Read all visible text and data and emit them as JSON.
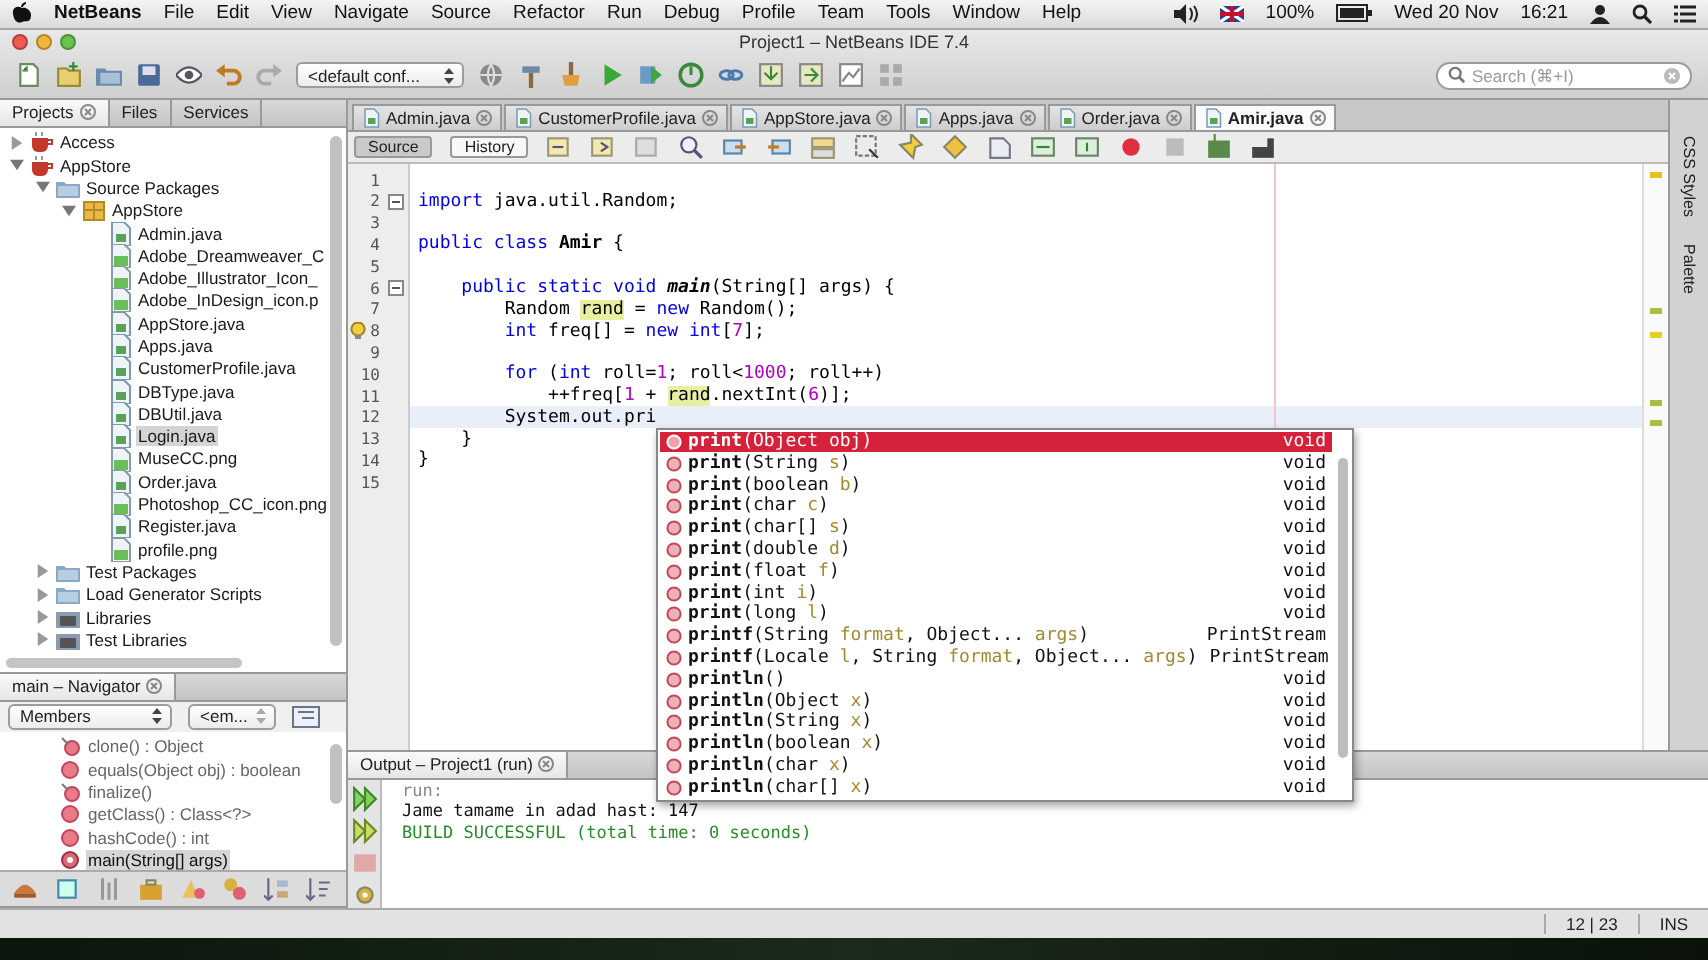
{
  "menubar": {
    "app": "NetBeans",
    "menus": [
      "File",
      "Edit",
      "View",
      "Navigate",
      "Source",
      "Refactor",
      "Run",
      "Debug",
      "Profile",
      "Team",
      "Tools",
      "Window",
      "Help"
    ],
    "battery": "100%",
    "date": "Wed 20 Nov",
    "time": "16:21"
  },
  "window": {
    "title": "Project1 – NetBeans IDE 7.4"
  },
  "toolbar": {
    "config": "<default conf...",
    "search": {
      "placeholder": "Search (⌘+I)"
    }
  },
  "projects_panel": {
    "tabs": [
      {
        "label": "Projects",
        "selected": true
      },
      {
        "label": "Files",
        "selected": false
      },
      {
        "label": "Services",
        "selected": false
      }
    ],
    "tree": [
      {
        "label": "Access",
        "kind": "project",
        "expanded": false,
        "selected": false
      },
      {
        "label": "AppStore",
        "kind": "project",
        "expanded": true,
        "selected": false,
        "children": [
          {
            "label": "Source Packages",
            "kind": "folder",
            "expanded": true,
            "selected": false,
            "children": [
              {
                "label": "AppStore",
                "kind": "package",
                "expanded": true,
                "selected": false,
                "children": [
                  {
                    "label": "Admin.java",
                    "kind": "java",
                    "selected": false
                  },
                  {
                    "label": "Adobe_Dreamweaver_C",
                    "kind": "image",
                    "selected": false
                  },
                  {
                    "label": "Adobe_Illustrator_Icon_",
                    "kind": "image",
                    "selected": false
                  },
                  {
                    "label": "Adobe_InDesign_icon.p",
                    "kind": "image",
                    "selected": false
                  },
                  {
                    "label": "AppStore.java",
                    "kind": "java",
                    "selected": false
                  },
                  {
                    "label": "Apps.java",
                    "kind": "java",
                    "selected": false
                  },
                  {
                    "label": "CustomerProfile.java",
                    "kind": "java",
                    "selected": false
                  },
                  {
                    "label": "DBType.java",
                    "kind": "java",
                    "selected": false
                  },
                  {
                    "label": "DBUtil.java",
                    "kind": "java",
                    "selected": false
                  },
                  {
                    "label": "Login.java",
                    "kind": "java",
                    "selected": true
                  },
                  {
                    "label": "MuseCC.png",
                    "kind": "image",
                    "selected": false
                  },
                  {
                    "label": "Order.java",
                    "kind": "java",
                    "selected": false
                  },
                  {
                    "label": "Photoshop_CC_icon.png",
                    "kind": "image",
                    "selected": false
                  },
                  {
                    "label": "Register.java",
                    "kind": "java",
                    "selected": false
                  },
                  {
                    "label": "profile.png",
                    "kind": "image",
                    "selected": false
                  }
                ]
              }
            ]
          },
          {
            "label": "Test Packages",
            "kind": "folder",
            "expanded": false,
            "selected": false
          },
          {
            "label": "Load Generator Scripts",
            "kind": "folder",
            "expanded": false,
            "selected": false
          },
          {
            "label": "Libraries",
            "kind": "library",
            "expanded": false,
            "selected": false
          },
          {
            "label": "Test Libraries",
            "kind": "library",
            "expanded": false,
            "selected": false
          }
        ]
      }
    ]
  },
  "navigator": {
    "title": "main – Navigator",
    "filter": "Members",
    "secondary": "<em...",
    "items": [
      {
        "label": "clone() : Object",
        "kind": "protected",
        "selected": false
      },
      {
        "label": "equals(Object obj) : boolean",
        "kind": "public",
        "selected": false
      },
      {
        "label": "finalize()",
        "kind": "protected",
        "selected": false
      },
      {
        "label": "getClass() : Class<?>",
        "kind": "public",
        "selected": false
      },
      {
        "label": "hashCode() : int",
        "kind": "public",
        "selected": false
      },
      {
        "label": "main(String[] args)",
        "kind": "static",
        "selected": true
      }
    ]
  },
  "editor": {
    "tabs": [
      {
        "label": "Admin.java",
        "selected": false
      },
      {
        "label": "CustomerProfile.java",
        "selected": false
      },
      {
        "label": "AppStore.java",
        "selected": false
      },
      {
        "label": "Apps.java",
        "selected": false
      },
      {
        "label": "Order.java",
        "selected": false
      },
      {
        "label": "Amir.java",
        "selected": true
      }
    ],
    "views": [
      {
        "label": "Source",
        "selected": true
      },
      {
        "label": "History",
        "selected": false
      }
    ],
    "lines": [
      {
        "number": "1",
        "fold": false,
        "hint": false,
        "current": false
      },
      {
        "number": "2",
        "fold": true,
        "hint": false,
        "current": false,
        "tokens": [
          {
            "text": "import",
            "kind": "kw"
          },
          {
            "text": " java.util.Random;",
            "kind": "plain"
          }
        ]
      },
      {
        "number": "3",
        "fold": false,
        "hint": false,
        "current": false
      },
      {
        "number": "4",
        "fold": false,
        "hint": false,
        "current": false,
        "tokens": [
          {
            "text": "public class",
            "kind": "kw"
          },
          {
            "text": " Amir",
            "kind": "bold"
          },
          {
            "text": " {",
            "kind": "plain"
          }
        ]
      },
      {
        "number": "5",
        "fold": false,
        "hint": false,
        "current": false
      },
      {
        "number": "6",
        "fold": true,
        "hint": false,
        "current": false,
        "tokens": [
          {
            "text": "    public static void",
            "kind": "kw"
          },
          {
            "text": " main",
            "kind": "method"
          },
          {
            "text": "(String[] args) {",
            "kind": "plain"
          }
        ]
      },
      {
        "number": "7",
        "fold": false,
        "hint": false,
        "current": false,
        "tokens": [
          {
            "text": "        Random ",
            "kind": "plain"
          },
          {
            "text": "rand",
            "kind": "mark"
          },
          {
            "text": " = ",
            "kind": "plain"
          },
          {
            "text": "new",
            "kind": "kw"
          },
          {
            "text": " Random();",
            "kind": "plain"
          }
        ]
      },
      {
        "number": "8",
        "fold": false,
        "hint": true,
        "current": false,
        "tokens": [
          {
            "text": "        int",
            "kind": "kw"
          },
          {
            "text": " freq[] = ",
            "kind": "plain"
          },
          {
            "text": "new int",
            "kind": "kw"
          },
          {
            "text": "[",
            "kind": "plain"
          },
          {
            "text": "7",
            "kind": "num"
          },
          {
            "text": "];",
            "kind": "plain"
          }
        ]
      },
      {
        "number": "9",
        "fold": false,
        "hint": false,
        "current": false
      },
      {
        "number": "10",
        "fold": false,
        "hint": false,
        "current": false,
        "tokens": [
          {
            "text": "        for",
            "kind": "kw"
          },
          {
            "text": " (",
            "kind": "plain"
          },
          {
            "text": "int",
            "kind": "kw"
          },
          {
            "text": " roll=",
            "kind": "plain"
          },
          {
            "text": "1",
            "kind": "num"
          },
          {
            "text": "; roll<",
            "kind": "plain"
          },
          {
            "text": "1000",
            "kind": "num"
          },
          {
            "text": "; roll++)",
            "kind": "plain"
          }
        ]
      },
      {
        "number": "11",
        "fold": false,
        "hint": false,
        "current": false,
        "tokens": [
          {
            "text": "            ++freq[",
            "kind": "plain"
          },
          {
            "text": "1",
            "kind": "num"
          },
          {
            "text": " + ",
            "kind": "plain"
          },
          {
            "text": "rand",
            "kind": "mark"
          },
          {
            "text": ".nextInt(",
            "kind": "plain"
          },
          {
            "text": "6",
            "kind": "num"
          },
          {
            "text": ")];",
            "kind": "plain"
          }
        ]
      },
      {
        "number": "12",
        "fold": false,
        "hint": false,
        "current": true,
        "tokens": [
          {
            "text": "        System.out.pri",
            "kind": "plain"
          }
        ]
      },
      {
        "number": "13",
        "fold": false,
        "hint": false,
        "current": false,
        "tokens": [
          {
            "text": "    }",
            "kind": "plain"
          }
        ]
      },
      {
        "number": "14",
        "fold": false,
        "hint": false,
        "current": false,
        "tokens": [
          {
            "text": "}",
            "kind": "plain"
          }
        ]
      },
      {
        "number": "15",
        "fold": false,
        "hint": false,
        "current": false
      }
    ],
    "completion": {
      "items": [
        {
          "selected": true,
          "tokens": [
            {
              "text": "print",
              "kind": "name"
            },
            {
              "text": "(Object ",
              "kind": "type"
            },
            {
              "text": "obj",
              "kind": "param"
            },
            {
              "text": ")",
              "kind": "type"
            }
          ],
          "returns": "void"
        },
        {
          "selected": false,
          "tokens": [
            {
              "text": "print",
              "kind": "name"
            },
            {
              "text": "(String ",
              "kind": "type"
            },
            {
              "text": "s",
              "kind": "param"
            },
            {
              "text": ")",
              "kind": "type"
            }
          ],
          "returns": "void"
        },
        {
          "selected": false,
          "tokens": [
            {
              "text": "print",
              "kind": "name"
            },
            {
              "text": "(boolean ",
              "kind": "type"
            },
            {
              "text": "b",
              "kind": "param"
            },
            {
              "text": ")",
              "kind": "type"
            }
          ],
          "returns": "void"
        },
        {
          "selected": false,
          "tokens": [
            {
              "text": "print",
              "kind": "name"
            },
            {
              "text": "(char ",
              "kind": "type"
            },
            {
              "text": "c",
              "kind": "param"
            },
            {
              "text": ")",
              "kind": "type"
            }
          ],
          "returns": "void"
        },
        {
          "selected": false,
          "tokens": [
            {
              "text": "print",
              "kind": "name"
            },
            {
              "text": "(char[] ",
              "kind": "type"
            },
            {
              "text": "s",
              "kind": "param"
            },
            {
              "text": ")",
              "kind": "type"
            }
          ],
          "returns": "void"
        },
        {
          "selected": false,
          "tokens": [
            {
              "text": "print",
              "kind": "name"
            },
            {
              "text": "(double ",
              "kind": "type"
            },
            {
              "text": "d",
              "kind": "param"
            },
            {
              "text": ")",
              "kind": "type"
            }
          ],
          "returns": "void"
        },
        {
          "selected": false,
          "tokens": [
            {
              "text": "print",
              "kind": "name"
            },
            {
              "text": "(float ",
              "kind": "type"
            },
            {
              "text": "f",
              "kind": "param"
            },
            {
              "text": ")",
              "kind": "type"
            }
          ],
          "returns": "void"
        },
        {
          "selected": false,
          "tokens": [
            {
              "text": "print",
              "kind": "name"
            },
            {
              "text": "(int ",
              "kind": "type"
            },
            {
              "text": "i",
              "kind": "param"
            },
            {
              "text": ")",
              "kind": "type"
            }
          ],
          "returns": "void"
        },
        {
          "selected": false,
          "tokens": [
            {
              "text": "print",
              "kind": "name"
            },
            {
              "text": "(long ",
              "kind": "type"
            },
            {
              "text": "l",
              "kind": "param"
            },
            {
              "text": ")",
              "kind": "type"
            }
          ],
          "returns": "void"
        },
        {
          "selected": false,
          "tokens": [
            {
              "text": "printf",
              "kind": "name"
            },
            {
              "text": "(String ",
              "kind": "type"
            },
            {
              "text": "format",
              "kind": "param"
            },
            {
              "text": ", Object... ",
              "kind": "type"
            },
            {
              "text": "args",
              "kind": "param"
            },
            {
              "text": ")",
              "kind": "type"
            }
          ],
          "returns": "PrintStream"
        },
        {
          "selected": false,
          "tokens": [
            {
              "text": "printf",
              "kind": "name"
            },
            {
              "text": "(Locale ",
              "kind": "type"
            },
            {
              "text": "l",
              "kind": "param"
            },
            {
              "text": ", String ",
              "kind": "type"
            },
            {
              "text": "format",
              "kind": "param"
            },
            {
              "text": ", Object... ",
              "kind": "type"
            },
            {
              "text": "args",
              "kind": "param"
            },
            {
              "text": ")",
              "kind": "type"
            }
          ],
          "returns": "PrintStream"
        },
        {
          "selected": false,
          "tokens": [
            {
              "text": "println",
              "kind": "name"
            },
            {
              "text": "()",
              "kind": "type"
            }
          ],
          "returns": "void"
        },
        {
          "selected": false,
          "tokens": [
            {
              "text": "println",
              "kind": "name"
            },
            {
              "text": "(Object ",
              "kind": "type"
            },
            {
              "text": "x",
              "kind": "param"
            },
            {
              "text": ")",
              "kind": "type"
            }
          ],
          "returns": "void"
        },
        {
          "selected": false,
          "tokens": [
            {
              "text": "println",
              "kind": "name"
            },
            {
              "text": "(String ",
              "kind": "type"
            },
            {
              "text": "x",
              "kind": "param"
            },
            {
              "text": ")",
              "kind": "type"
            }
          ],
          "returns": "void"
        },
        {
          "selected": false,
          "tokens": [
            {
              "text": "println",
              "kind": "name"
            },
            {
              "text": "(boolean ",
              "kind": "type"
            },
            {
              "text": "x",
              "kind": "param"
            },
            {
              "text": ")",
              "kind": "type"
            }
          ],
          "returns": "void"
        },
        {
          "selected": false,
          "tokens": [
            {
              "text": "println",
              "kind": "name"
            },
            {
              "text": "(char ",
              "kind": "type"
            },
            {
              "text": "x",
              "kind": "param"
            },
            {
              "text": ")",
              "kind": "type"
            }
          ],
          "returns": "void"
        },
        {
          "selected": false,
          "tokens": [
            {
              "text": "println",
              "kind": "name"
            },
            {
              "text": "(char[] ",
              "kind": "type"
            },
            {
              "text": "x",
              "kind": "param"
            },
            {
              "text": ")",
              "kind": "type"
            }
          ],
          "returns": "void"
        }
      ]
    }
  },
  "side_tabs": [
    "CSS Styles",
    "Palette"
  ],
  "output": {
    "title": "Output – Project1 (run)",
    "lines": [
      {
        "text": "run:",
        "kind": "info"
      },
      {
        "text": "Jame tamame in adad hast: 147",
        "kind": "plain"
      },
      {
        "text": "BUILD SUCCESSFUL (total time: 0 seconds)",
        "kind": "success"
      }
    ]
  },
  "status_bar": {
    "position": "12 | 23",
    "mode": "INS"
  }
}
